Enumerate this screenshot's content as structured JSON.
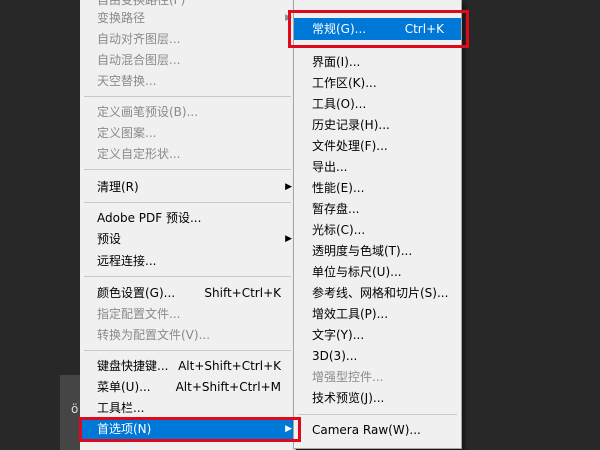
{
  "background": {
    "glyph": "ö"
  },
  "main_menu": {
    "items": [
      {
        "label": "自由变换路径(F)",
        "disabled": true
      },
      {
        "label": "变换路径",
        "disabled": true,
        "submenu": true
      },
      {
        "label": "自动对齐图层...",
        "disabled": true
      },
      {
        "label": "自动混合图层...",
        "disabled": true
      },
      {
        "label": "天空替换...",
        "disabled": true
      },
      {
        "label": "定义画笔预设(B)...",
        "disabled": true
      },
      {
        "label": "定义图案...",
        "disabled": true
      },
      {
        "label": "定义自定形状...",
        "disabled": true
      },
      {
        "label": "清理(R)",
        "submenu": true
      },
      {
        "label": "Adobe PDF 预设..."
      },
      {
        "label": "预设",
        "submenu": true
      },
      {
        "label": "远程连接..."
      },
      {
        "label": "颜色设置(G)...",
        "shortcut": "Shift+Ctrl+K"
      },
      {
        "label": "指定配置文件...",
        "disabled": true
      },
      {
        "label": "转换为配置文件(V)...",
        "disabled": true
      },
      {
        "label": "键盘快捷键...",
        "shortcut": "Alt+Shift+Ctrl+K"
      },
      {
        "label": "菜单(U)...",
        "shortcut": "Alt+Shift+Ctrl+M"
      },
      {
        "label": "工具栏..."
      },
      {
        "label": "首选项(N)",
        "submenu": true,
        "highlight": true
      }
    ]
  },
  "sub_menu": {
    "items": [
      {
        "label": "常规(G)...",
        "shortcut": "Ctrl+K",
        "highlight": true
      },
      {
        "label": "界面(I)..."
      },
      {
        "label": "工作区(K)..."
      },
      {
        "label": "工具(O)..."
      },
      {
        "label": "历史记录(H)..."
      },
      {
        "label": "文件处理(F)..."
      },
      {
        "label": "导出..."
      },
      {
        "label": "性能(E)..."
      },
      {
        "label": "暂存盘..."
      },
      {
        "label": "光标(C)..."
      },
      {
        "label": "透明度与色域(T)..."
      },
      {
        "label": "单位与标尺(U)..."
      },
      {
        "label": "参考线、网格和切片(S)..."
      },
      {
        "label": "增效工具(P)..."
      },
      {
        "label": "文字(Y)..."
      },
      {
        "label": "3D(3)..."
      },
      {
        "label": "增强型控件...",
        "disabled": true
      },
      {
        "label": "技术预览(J)..."
      },
      {
        "label": "Camera Raw(W)..."
      }
    ]
  },
  "colors": {
    "highlight": "#0078d7",
    "annotation": "#e0081c",
    "disabled_text": "#8a8a8a",
    "menu_bg": "#f0f0f0"
  }
}
